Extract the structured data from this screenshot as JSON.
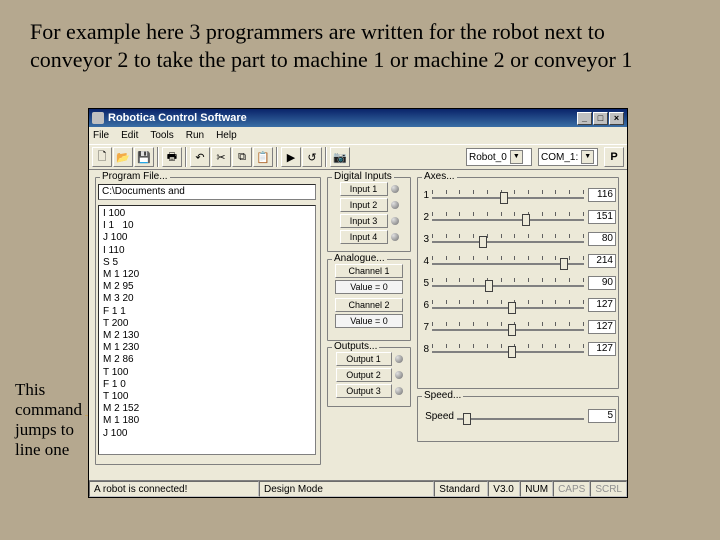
{
  "slide": {
    "title": "For example here 3 programmers are written for the robot next to conveyor 2 to take the part to machine 1 or machine 2 or conveyor 1",
    "annotation": "This command jumps to line one"
  },
  "window": {
    "title": "Robotica Control Software",
    "menu": {
      "file": "File",
      "edit": "Edit",
      "tools": "Tools",
      "run": "Run",
      "help": "Help"
    },
    "toolbar": {
      "robot_combo": "Robot_0",
      "com_combo": "COM_1:",
      "p_button": "P"
    },
    "program": {
      "group_label": "Program File...",
      "filepath": "C:\\Documents and",
      "lines": [
        "I 100",
        "I 1   10",
        "J 100",
        "I 110",
        "S 5",
        "M 1 120",
        "M 2 95",
        "M 3 20",
        "F 1 1",
        "T 200",
        "M 2 130",
        "M 1 230",
        "M 2 86",
        "T 100",
        "F 1 0",
        "T 100",
        "M 2 152",
        "M 1 180",
        "J 100"
      ]
    },
    "digital_inputs": {
      "label": "Digital Inputs",
      "items": [
        "Input 1",
        "Input 2",
        "Input 3",
        "Input 4"
      ]
    },
    "analogue": {
      "label": "Analogue...",
      "channel1": "Channel 1",
      "value1": "Value = 0",
      "channel2": "Channel 2",
      "value2": "Value = 0"
    },
    "outputs": {
      "label": "Outputs...",
      "items": [
        "Output 1",
        "Output 2",
        "Output 3"
      ]
    },
    "axes": {
      "label": "Axes...",
      "rows": [
        {
          "n": "1",
          "val": "116",
          "pos": 45
        },
        {
          "n": "2",
          "val": "151",
          "pos": 59
        },
        {
          "n": "3",
          "val": "80",
          "pos": 31
        },
        {
          "n": "4",
          "val": "214",
          "pos": 84
        },
        {
          "n": "5",
          "val": "90",
          "pos": 35
        },
        {
          "n": "6",
          "val": "127",
          "pos": 50
        },
        {
          "n": "7",
          "val": "127",
          "pos": 50
        },
        {
          "n": "8",
          "val": "127",
          "pos": 50
        }
      ]
    },
    "speed": {
      "label": "Speed...",
      "inner_label": "Speed",
      "value": "5",
      "pos": 5
    },
    "status": {
      "connected": "A robot is connected!",
      "mode": "Design Mode",
      "standard": "Standard",
      "version": "V3.0",
      "num": "NUM",
      "caps": "CAPS",
      "scrl": "SCRL"
    }
  }
}
